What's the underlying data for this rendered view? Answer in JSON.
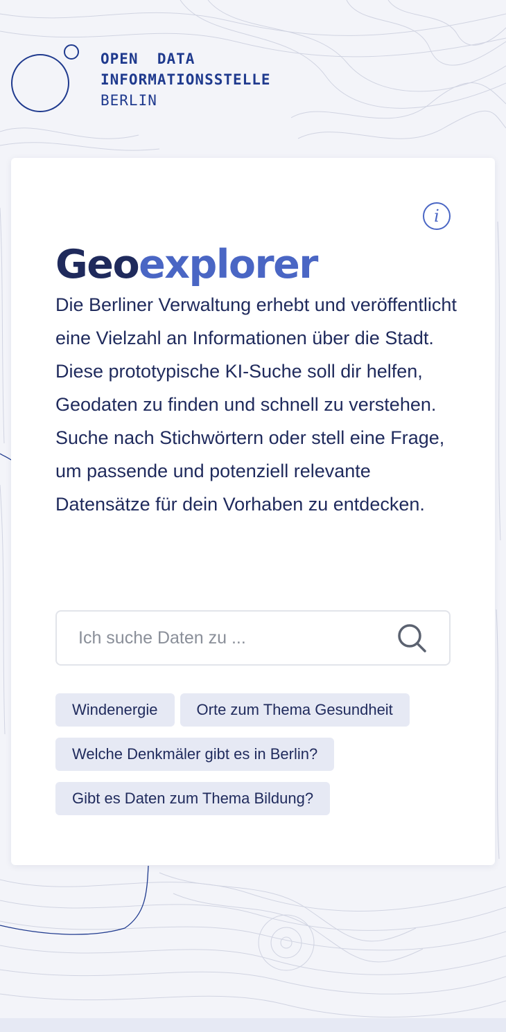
{
  "logo": {
    "line1": "OPEN  DATA",
    "line2": "INFORMATIONSSTELLE",
    "line3": "BERLIN"
  },
  "info_button": {
    "glyph": "i",
    "icon": "info-icon"
  },
  "title": {
    "part1": "Geo",
    "part2": "explorer"
  },
  "description": "Die Berliner Verwaltung erhebt und veröffentlicht eine Vielzahl an Informationen über die Stadt. Diese prototypische KI-Suche soll dir helfen, Geodaten zu finden und schnell zu verstehen. Suche nach Stichwörtern oder stell eine Frage, um passende und potenziell relevante Datensätze für dein Vorhaben zu entdecken.",
  "search": {
    "placeholder": "Ich suche Daten zu ...",
    "value": "",
    "icon": "search-icon"
  },
  "suggestions": [
    "Windenergie",
    "Orte zum Thema Gesundheit",
    "Welche Denkmäler gibt es in Berlin?",
    "Gibt es Daten zum Thema Bildung?"
  ],
  "colors": {
    "navy": "#1f2a5c",
    "accent_blue": "#4a66c4",
    "logo_blue": "#1f3a8e",
    "chip_bg": "#e6e9f4",
    "page_bg": "#f3f4f9"
  }
}
